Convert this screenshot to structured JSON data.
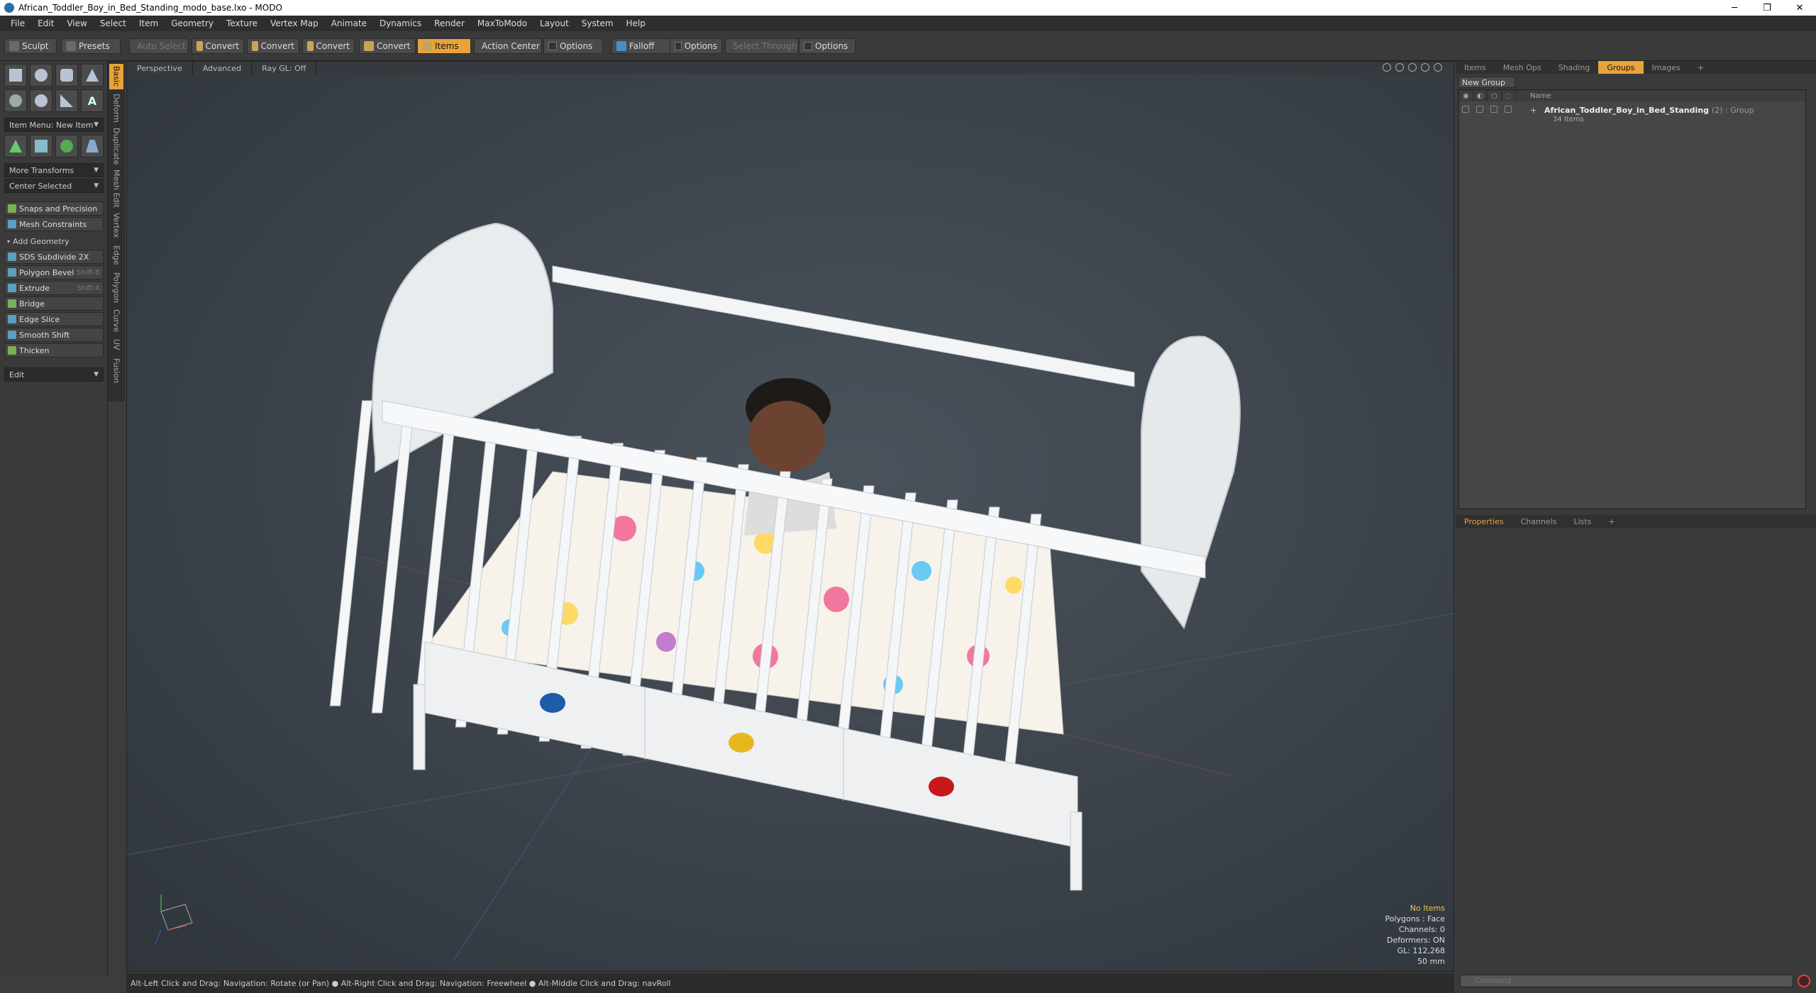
{
  "window": {
    "title": "African_Toddler_Boy_in_Bed_Standing_modo_base.lxo - MODO",
    "minimize": "─",
    "maximize": "❐",
    "close": "✕"
  },
  "menu": [
    "File",
    "Edit",
    "View",
    "Select",
    "Item",
    "Geometry",
    "Texture",
    "Vertex Map",
    "Animate",
    "Dynamics",
    "Render",
    "MaxToModo",
    "Layout",
    "System",
    "Help"
  ],
  "toolbar": {
    "sculpt": "Sculpt",
    "presets": "Presets",
    "auto_select": "Auto Select",
    "convert": "Convert",
    "items": "Items",
    "action_center": "Action Center",
    "options": "Options",
    "falloff": "Falloff",
    "select_through": "Select Through"
  },
  "left": {
    "item_menu": "Item Menu: New Item",
    "more_transforms": "More Transforms",
    "center_selected": "Center Selected",
    "snaps": "Snaps and Precision",
    "mesh_constraints": "Mesh Constraints",
    "add_geometry": "Add Geometry",
    "tools": [
      {
        "label": "SDS Subdivide 2X",
        "shortcut": ""
      },
      {
        "label": "Polygon Bevel",
        "shortcut": "Shift-B"
      },
      {
        "label": "Extrude",
        "shortcut": "Shift-X"
      },
      {
        "label": "Bridge",
        "shortcut": ""
      },
      {
        "label": "Edge Slice",
        "shortcut": ""
      },
      {
        "label": "Smooth Shift",
        "shortcut": ""
      },
      {
        "label": "Thicken",
        "shortcut": ""
      }
    ],
    "edit": "Edit",
    "vtabs": [
      "Basic",
      "Deform",
      "Duplicate",
      "Mesh Edit",
      "Vertex",
      "Edge",
      "Polygon",
      "Curve",
      "UV",
      "Fusion"
    ]
  },
  "viewport": {
    "tabs": [
      "Perspective",
      "Advanced",
      "Ray GL: Off"
    ],
    "info": {
      "items": "No Items",
      "polygons": "Polygons : Face",
      "channels": "Channels: 0",
      "deformers": "Deformers: ON",
      "gl": "GL: 112,268",
      "size": "50 mm"
    }
  },
  "status": "Alt-Left Click and Drag: Navigation: Rotate (or Pan) ● Alt-Right Click and Drag: Navigation: Freewheel ● Alt-Middle Click and Drag: navRoll",
  "right": {
    "tabs": [
      "Items",
      "Mesh Ops",
      "Shading",
      "Groups",
      "Images",
      "+"
    ],
    "new_group": "New Group",
    "col_name": "Name",
    "group": {
      "name": "African_Toddler_Boy_in_Bed_Standing",
      "tag": "(2) : Group",
      "count": "34 Items"
    },
    "bottom_tabs": [
      "Properties",
      "Channels",
      "Lists",
      "+"
    ],
    "command_placeholder": "Command"
  }
}
